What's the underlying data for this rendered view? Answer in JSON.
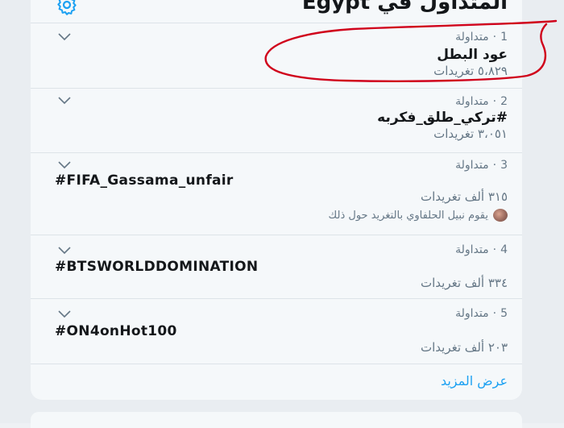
{
  "header": {
    "title": "المتداول في Egypt",
    "settings_icon": "gear-icon"
  },
  "trends": [
    {
      "rank": "1",
      "status": "متداولة",
      "name": "عود البطل",
      "tweets": "٥،٨٢٩ تغريدات"
    },
    {
      "rank": "2",
      "status": "متداولة",
      "name": "#تركي_طلق_فكربه",
      "tweets": "٣،٠٥١ تغريدات"
    },
    {
      "rank": "3",
      "status": "متداولة",
      "name": "#FIFA_Gassama_unfair",
      "tweets": "٣١٥ ألف تغريدات",
      "context": "يقوم نبيل الحلفاوي بالتغريد حول ذلك"
    },
    {
      "rank": "4",
      "status": "متداولة",
      "name": "#BTSWORLDDOMINATION",
      "tweets": "٣٣٤ ألف تغريدات"
    },
    {
      "rank": "5",
      "status": "متداولة",
      "name": "#ON4onHot100",
      "tweets": "٢٠٣ ألف تغريدات"
    }
  ],
  "footer": {
    "show_more": "عرض المزيد"
  },
  "colors": {
    "accent": "#1da1f2",
    "annotation": "#d0021b",
    "text_primary": "#14171a",
    "text_secondary": "#657786"
  }
}
